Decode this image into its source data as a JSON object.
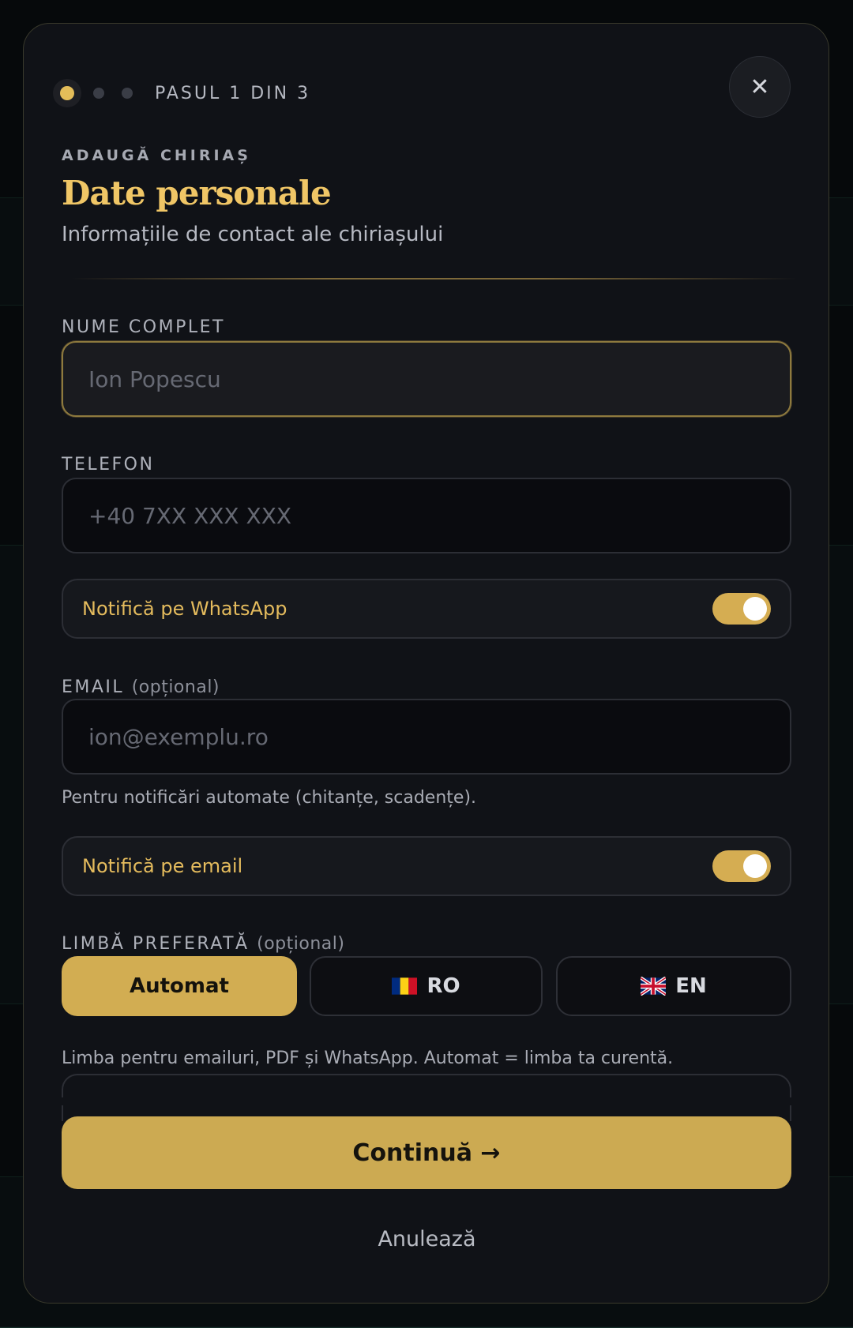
{
  "modal": {
    "step_label": "PASUL 1 DIN 3",
    "close_label": "✕",
    "eyebrow": "ADAUGĂ CHIRIAȘ",
    "title": "Date personale",
    "subtitle": "Informațiile de contact ale chiriașului"
  },
  "form": {
    "name": {
      "label": "NUME COMPLET",
      "placeholder": "Ion Popescu",
      "value": ""
    },
    "phone": {
      "label": "TELEFON",
      "placeholder": "+40 7XX XXX XXX",
      "value": ""
    },
    "whatsapp_toggle": {
      "label": "Notifică pe WhatsApp",
      "on": true
    },
    "email": {
      "label": "EMAIL",
      "optional": "(opțional)",
      "placeholder": "ion@exemplu.ro",
      "value": "",
      "helper": "Pentru notificări automate (chitanțe, scadențe)."
    },
    "email_toggle": {
      "label": "Notifică pe email",
      "on": true
    },
    "language": {
      "label": "LIMBĂ PREFERATĂ",
      "optional": "(opțional)",
      "options": [
        {
          "label": "Automat",
          "selected": true
        },
        {
          "label": "RO",
          "icon": "romania-flag-icon",
          "selected": false
        },
        {
          "label": "EN",
          "icon": "uk-flag-icon",
          "selected": false
        }
      ],
      "helper": "Limba pentru emailuri, PDF și WhatsApp. Automat = limba ta curentă."
    }
  },
  "actions": {
    "continue_label": "Continuă →",
    "cancel_label": "Anulează"
  },
  "colors": {
    "accent": "#d2ad52",
    "title": "#f0c666",
    "modal_bg": "#101217"
  }
}
